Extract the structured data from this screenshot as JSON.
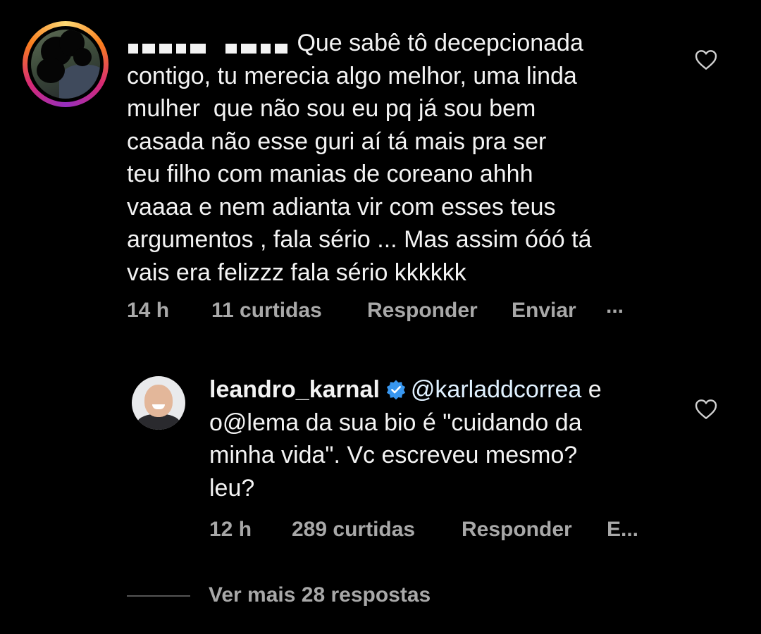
{
  "comment1": {
    "avatar_icon": "blurred-profile-photo",
    "text_lines": [
      "Que sabê tô decepcionada",
      "contigo, tu merecia algo melhor, uma linda",
      "mulher  que não sou eu pq já sou bem",
      "casada não esse guri aí tá mais pra ser",
      "teu filho com manias de coreano ahhh",
      "vaaaa e nem adianta vir com esses teus",
      "argumentos , fala sério ... Mas assim óóó tá",
      "vais era felizzz fala sério kkkkkk"
    ],
    "time": "14 h",
    "likes": "11 curtidas",
    "reply_label": "Responder",
    "send_label": "Enviar",
    "more_label": "..."
  },
  "comment2": {
    "username": "leandro_karnal",
    "verified_icon": "verified-badge-icon",
    "mention": "@karladdcorrea",
    "text_lines": [
      " e",
      "o@lema da sua bio é \"cuidando da",
      "minha vida\". Vc escreveu mesmo?",
      "leu?"
    ],
    "time": "12 h",
    "likes": "289 curtidas",
    "reply_label": "Responder",
    "send_label": "E..."
  },
  "view_more": {
    "label": "Ver mais 28 respostas"
  },
  "colors": {
    "background": "#000000",
    "text": "#f3f3f3",
    "meta": "#a8a8a8",
    "verified": "#3897f0"
  }
}
